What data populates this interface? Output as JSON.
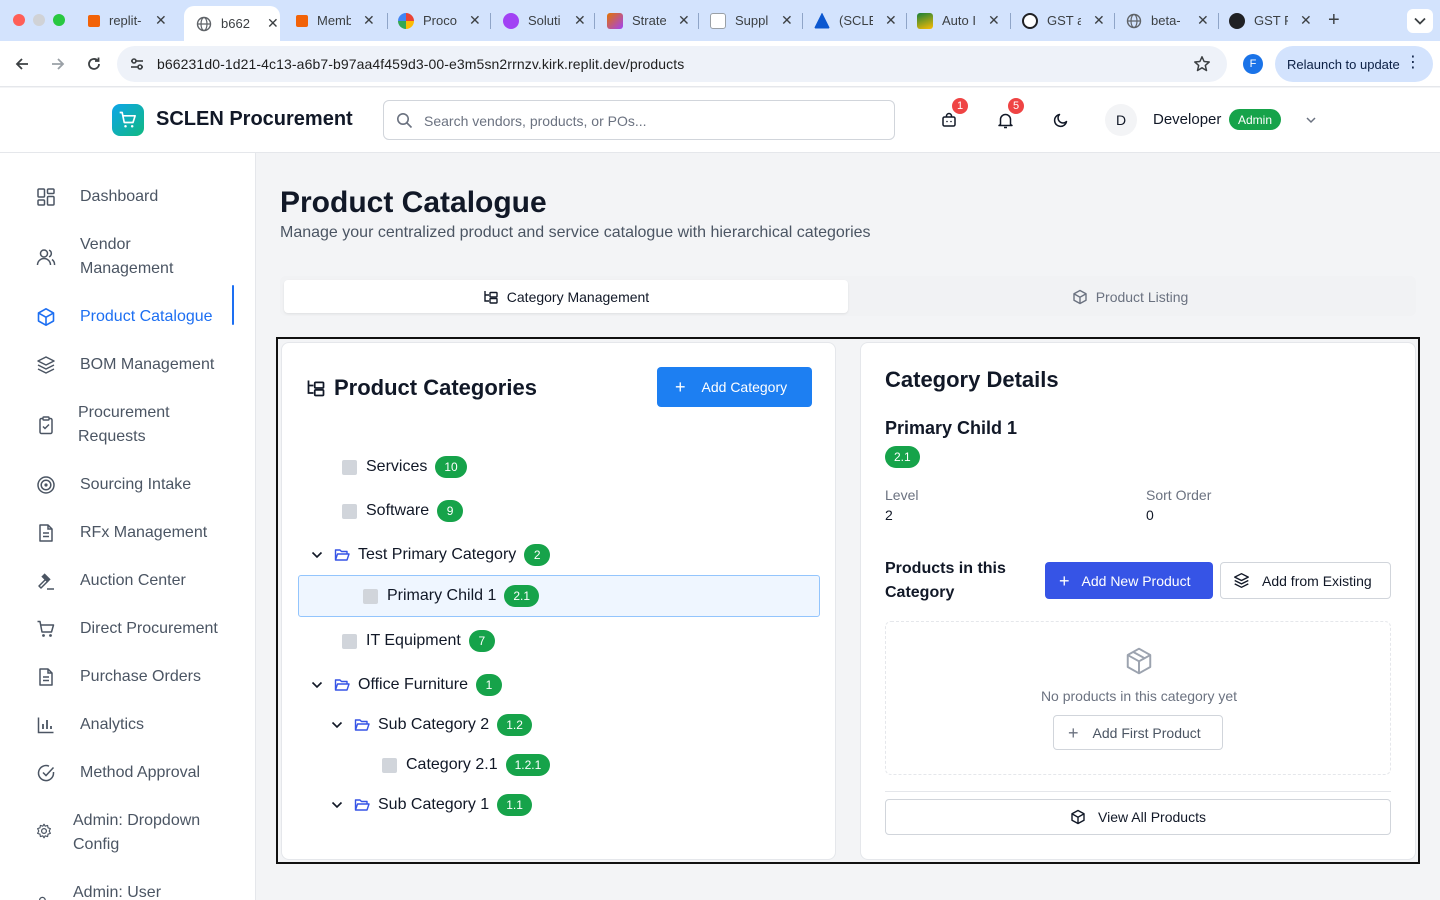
{
  "browser": {
    "tabs": [
      {
        "title": "replit-",
        "color": "#f26207"
      },
      {
        "title": "b662",
        "color": "#5f6368"
      },
      {
        "title": "Memb",
        "color": "#f26207"
      },
      {
        "title": "Proco",
        "color": "#4285f4"
      },
      {
        "title": "Soluti",
        "color": "#a142f4"
      },
      {
        "title": "Strate",
        "color": "#e37400"
      },
      {
        "title": "Suppl",
        "color": "#0b57d0"
      },
      {
        "title": "(SCLE",
        "color": "#0b57d0"
      },
      {
        "title": "Auto I",
        "color": "#188038"
      },
      {
        "title": "GST a",
        "color": "#202124"
      },
      {
        "title": "beta-",
        "color": "#5f6368"
      },
      {
        "title": "GST F",
        "color": "#202124"
      }
    ],
    "url": "b66231d0-1d21-4c13-a6b7-b97aa4f459d3-00-e3m5sn2rrnzv.kirk.replit.dev/products",
    "profile_initial": "F",
    "relaunch_label": "Relaunch to update"
  },
  "header": {
    "brand": "SCLEN Procurement",
    "search_placeholder": "Search vendors, products, or POs...",
    "cart_badge": "1",
    "notifications_badge": "5",
    "avatar_initial": "D",
    "user_name": "Developer",
    "role": "Admin"
  },
  "sidebar": {
    "items": [
      {
        "label": "Dashboard",
        "icon": "dashboard-icon"
      },
      {
        "label": "Vendor Management",
        "icon": "users-icon"
      },
      {
        "label": "Product Catalogue",
        "icon": "box-icon"
      },
      {
        "label": "BOM Management",
        "icon": "layers-icon"
      },
      {
        "label": "Procurement Requests",
        "icon": "clipboard-icon"
      },
      {
        "label": "Sourcing Intake",
        "icon": "target-icon"
      },
      {
        "label": "RFx Management",
        "icon": "file-icon"
      },
      {
        "label": "Auction Center",
        "icon": "gavel-icon"
      },
      {
        "label": "Direct Procurement",
        "icon": "cart-icon"
      },
      {
        "label": "Purchase Orders",
        "icon": "file-icon"
      },
      {
        "label": "Analytics",
        "icon": "chart-icon"
      },
      {
        "label": "Method Approval",
        "icon": "check-circle-icon"
      },
      {
        "label": "Admin: Dropdown Config",
        "icon": "gear-icon"
      },
      {
        "label": "Admin: User",
        "icon": "users-icon"
      }
    ]
  },
  "page": {
    "title": "Product Catalogue",
    "subtitle": "Manage your centralized product and service catalogue with hierarchical categories",
    "tab_category": "Category Management",
    "tab_products": "Product Listing"
  },
  "categories": {
    "title": "Product Categories",
    "add_label": "Add Category",
    "tree": [
      {
        "name": "Services",
        "code": "10"
      },
      {
        "name": "Software",
        "code": "9"
      },
      {
        "name": "Test Primary Category",
        "code": "2"
      },
      {
        "name": "Primary Child 1",
        "code": "2.1"
      },
      {
        "name": "IT Equipment",
        "code": "7"
      },
      {
        "name": "Office Furniture",
        "code": "1"
      },
      {
        "name": "Sub Category 2",
        "code": "1.2"
      },
      {
        "name": "Category 2.1",
        "code": "1.2.1"
      },
      {
        "name": "Sub Category 1",
        "code": "1.1"
      }
    ]
  },
  "details": {
    "title": "Category Details",
    "name": "Primary Child 1",
    "code": "2.1",
    "level_label": "Level",
    "level_value": "2",
    "sort_label": "Sort Order",
    "sort_value": "0",
    "products_label": "Products in this Category",
    "add_new_label": "Add New Product",
    "add_existing_label": "Add from Existing",
    "empty_text": "No products in this category yet",
    "add_first_label": "Add First Product",
    "view_all_label": "View All Products"
  },
  "colors": {
    "primary": "#1d7ff2",
    "indigo": "#3654e6",
    "success": "#16a34a",
    "danger": "#ef4444"
  }
}
